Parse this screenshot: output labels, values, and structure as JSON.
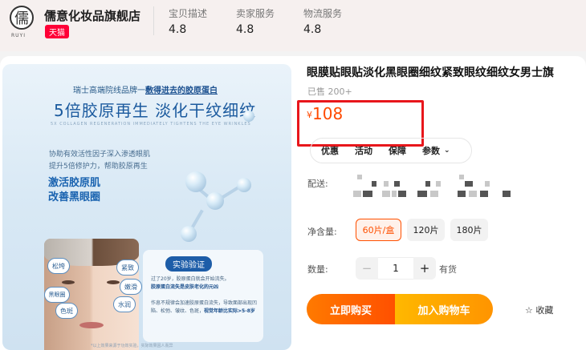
{
  "shop": {
    "logo_char": "儒",
    "logo_sub": "RUYI",
    "name": "儒意化妆品旗舰店",
    "badge": "天猫",
    "stats": [
      {
        "label": "宝贝描述",
        "value": "4.8"
      },
      {
        "label": "卖家服务",
        "value": "4.8"
      },
      {
        "label": "物流服务",
        "value": "4.8"
      }
    ]
  },
  "image": {
    "tagline_prefix": "瑞士高端院线品牌一",
    "tagline_highlight": "敷得进去的胶原蛋白",
    "headline": "5倍胶原再生 淡化干纹细纹",
    "en_line": "5X COLLAGEN REGENERATION IMMEDIATELY TIGHTENS THE EYE WRINKLES",
    "desc1": "协助有效活性因子深入渗透眼肌",
    "desc2": "提升5倍修护力，帮助胶原再生",
    "feature1": "激活胶原肌",
    "feature2": "改善黑眼圈",
    "tags": [
      "松垮",
      "黑眼圈",
      "色斑",
      "紧致",
      "嫩滑",
      "水润"
    ],
    "verify_title": "实验验证",
    "verify_p1": "过了20岁，胶原蛋白就会开始流失。",
    "verify_p1b": "胶原蛋白流失是皮肤老化的元凶",
    "verify_p2": "作息不规律会加速胶原蛋白流失，导致面部出现凹陷、松弛、皱纹、色斑，",
    "verify_p2b": "视觉年龄比实际>5-8岁",
    "footnote": "*以上效果来源于功效实验，实际效果因人而异"
  },
  "product": {
    "title": "眼膜贴眼贴淡化黑眼圈细纹紧致眼纹细纹女男士旗",
    "sold": "已售 200+",
    "currency": "¥",
    "price": "108",
    "tabs": [
      "优惠",
      "活动",
      "保障",
      "参数"
    ],
    "shipping_label": "配送:",
    "size_label": "净含量:",
    "sizes": [
      "60片/盒",
      "120片",
      "180片"
    ],
    "selected_size": "60片/盒",
    "qty_label": "数量:",
    "qty": "1",
    "stock": "有货",
    "buy_label": "立即购买",
    "cart_label": "加入购物车",
    "fav_label": "☆ 收藏"
  },
  "colors": {
    "price": "#ff4a00",
    "highlight_box": "#e8161b",
    "buy": "#ff5000",
    "cart": "#ff9400"
  }
}
